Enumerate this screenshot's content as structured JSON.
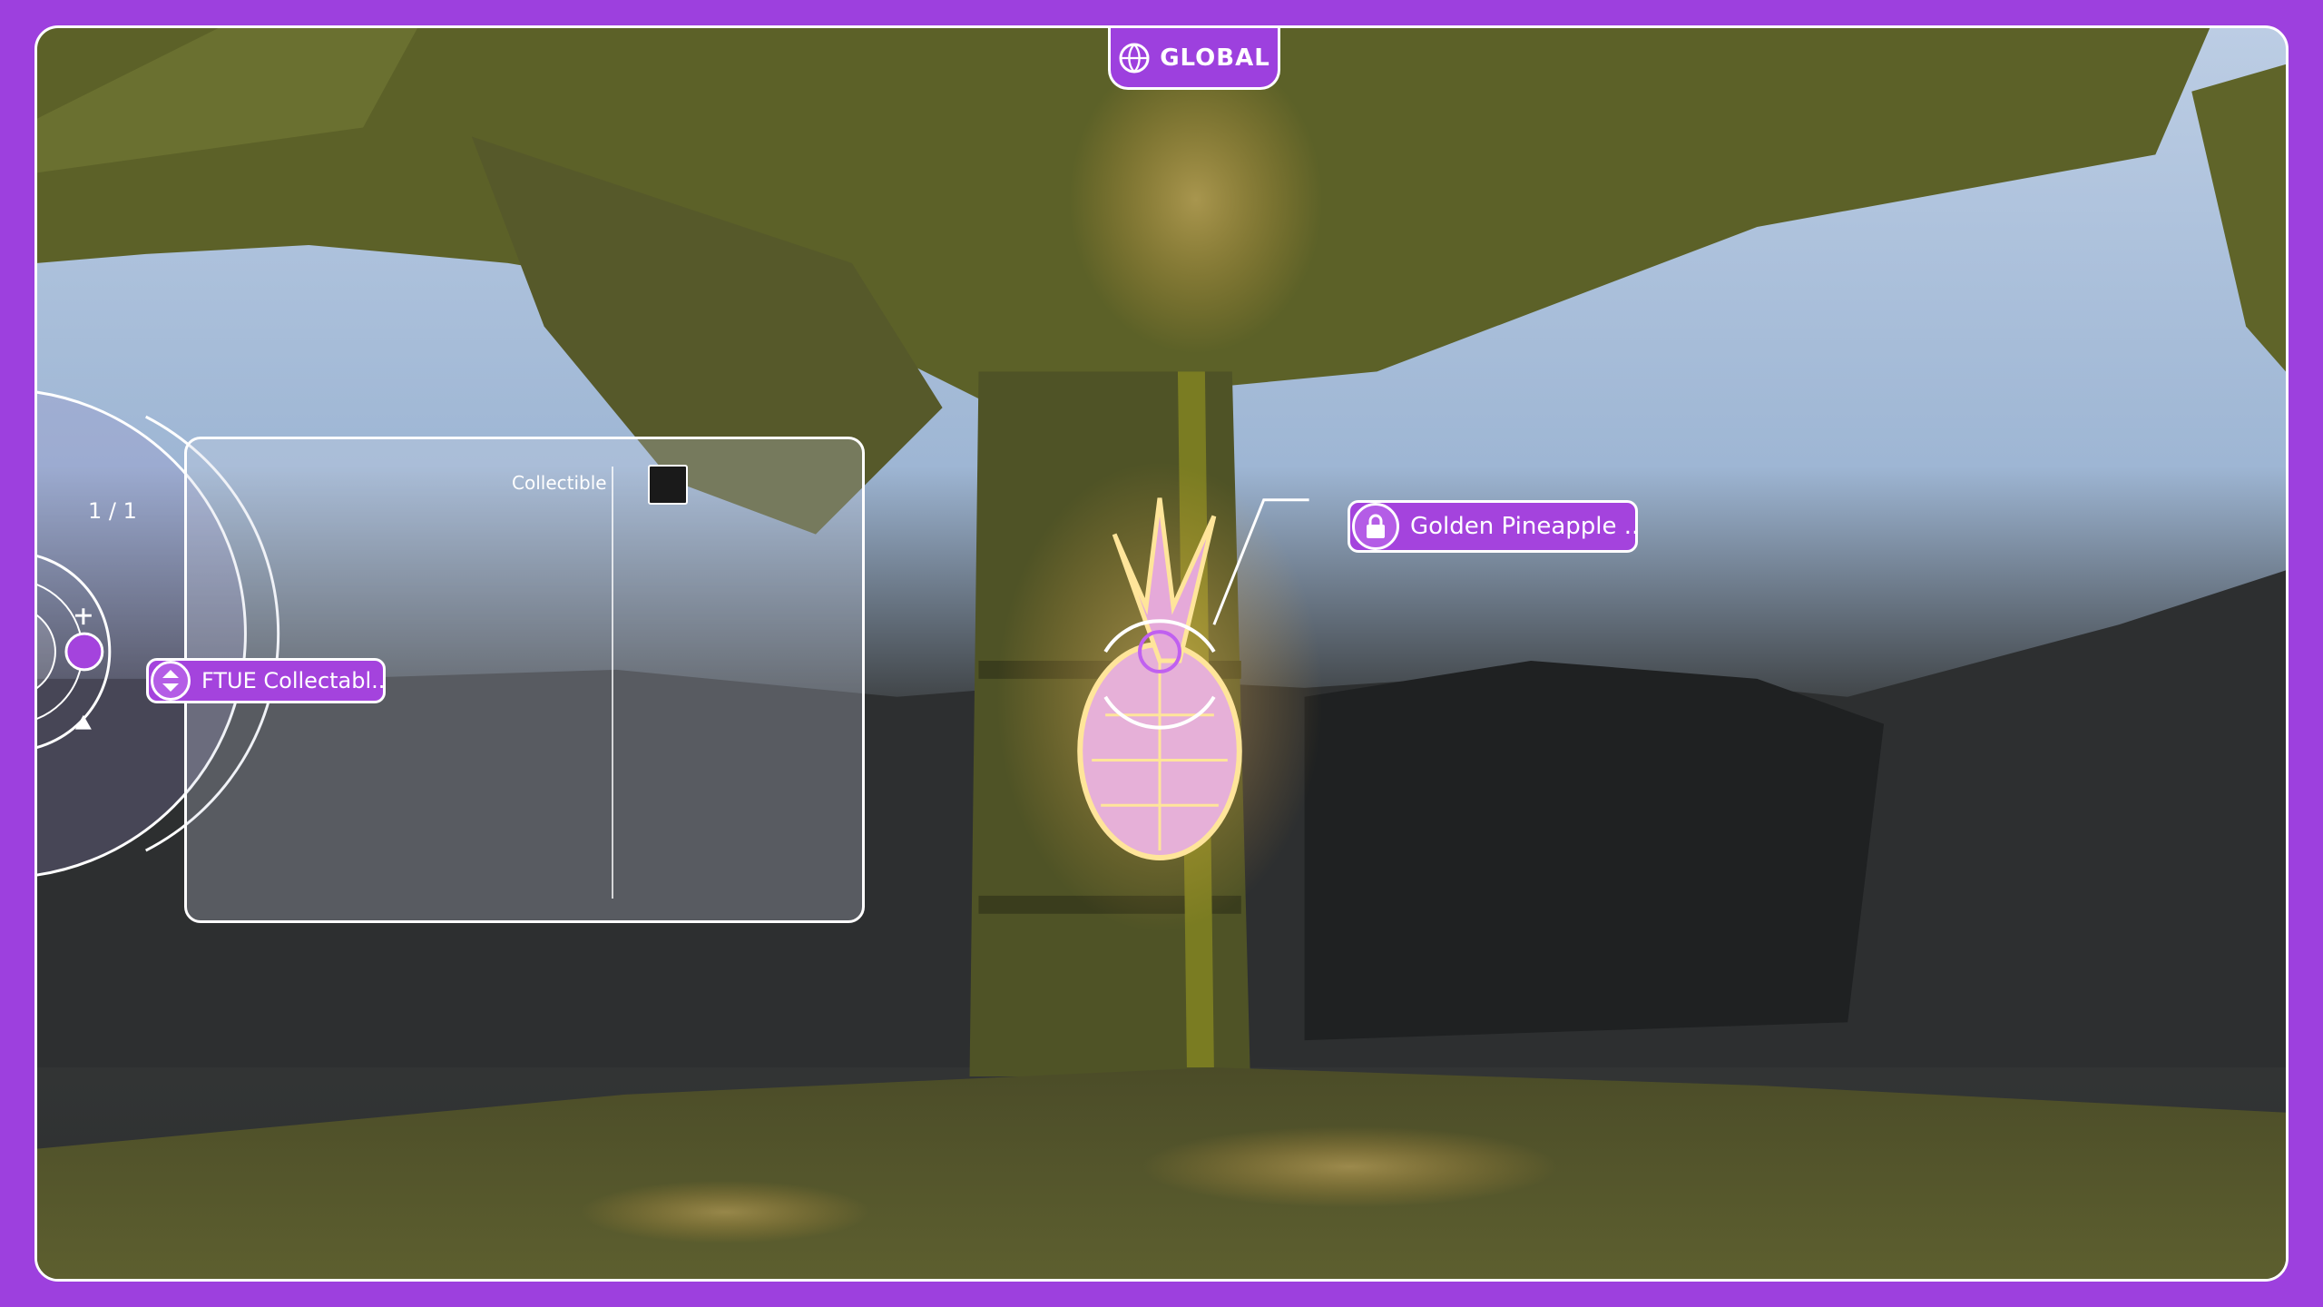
{
  "top_tab": {
    "label": "GLOBAL",
    "icon": "globe-icon"
  },
  "side_panel": {
    "counter": "1 / 1",
    "property_label": "Collectible",
    "swatch_color": "#1a1a1a"
  },
  "left_chip": {
    "label": "FTUE Collectabl...",
    "icon": "up-down-arrows-icon"
  },
  "object_chip": {
    "label": "Golden Pineapple ...",
    "icon": "lock-icon"
  },
  "colors": {
    "accent": "#9d40de",
    "chip": "#a443dd",
    "glow": "#ffd27a"
  }
}
